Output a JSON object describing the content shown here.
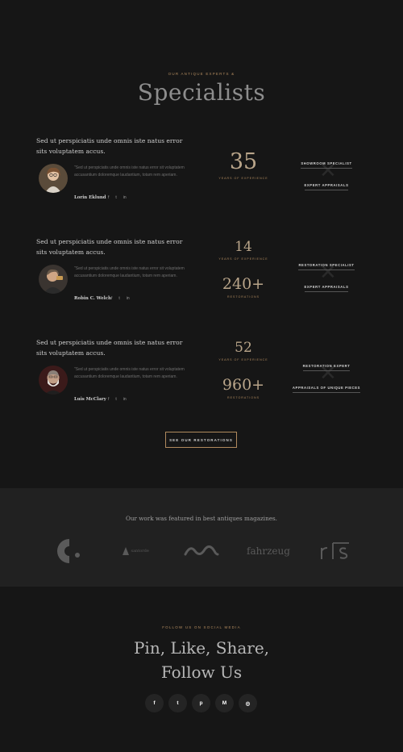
{
  "header": {
    "eyebrow": "OUR ANTIQUE EXPERTS &",
    "title": "Specialists"
  },
  "specialists": [
    {
      "lead": "Sed ut perspiciatis unde omnis iste natus error sits voluptatem accus.",
      "quote": "\"Sed ut perspiciatis unde omnis iste natus error sit voluptatem accusantium doloremque laudantium, totam rem aperiam.",
      "name": "Lorin Eklund",
      "stats": [
        {
          "num": "35",
          "label": "YEARS OF EXPERIENCE"
        }
      ],
      "roles": [
        "SHOWROOM SPECIALIST",
        "EXPERT APPRAISALS"
      ]
    },
    {
      "lead": "Sed ut perspiciatis unde omnis iste natus error sits voluptatem accus.",
      "quote": "\"Sed ut perspiciatis unde omnis iste natus error sit voluptatem accusantium doloremque laudantium, totam rem aperiam.",
      "name": "Robin C. Welch",
      "stats": [
        {
          "num": "14",
          "label": "YEARS OF EXPERIENCE"
        },
        {
          "num": "240+",
          "label": "RESTORATIONS"
        }
      ],
      "roles": [
        "RESTORATION SPECIALIST",
        "EXPERT APPRAISALS"
      ]
    },
    {
      "lead": "Sed ut perspiciatis unde omnis iste natus error sits voluptatem accus.",
      "quote": "\"Sed ut perspiciatis unde omnis iste natus error sit voluptatem accusantium doloremque laudantium, totam rem aperiam.",
      "name": "Luis McClary",
      "stats": [
        {
          "num": "52",
          "label": "YEARS OF EXPERIENCE"
        },
        {
          "num": "960+",
          "label": "RESTORATIONS"
        }
      ],
      "roles": [
        "RESTORATION EXPERT",
        "APPRAISALS OF UNIQUE PIECES"
      ]
    }
  ],
  "social_icons": [
    "f",
    "t",
    "in"
  ],
  "cta": {
    "label": "SEE OUR RESTORATIONS"
  },
  "featured": {
    "title": "Our work was featured in best antiques magazines.",
    "logos": [
      {
        "name": "c-logo",
        "text": ""
      },
      {
        "name": "santorde-logo",
        "text": "santorde"
      },
      {
        "name": "wave-logo",
        "text": ""
      },
      {
        "name": "fahrzeug-logo",
        "text": "fahrzeug"
      },
      {
        "name": "rs-logo",
        "text": "r|s"
      }
    ]
  },
  "footer": {
    "eyebrow": "FOLLOW US ON SOCIAL MEDIA",
    "title_line1": "Pin, Like, Share,",
    "title_line2": "Follow Us",
    "social_buttons": [
      {
        "name": "facebook",
        "glyph": "f"
      },
      {
        "name": "twitter",
        "glyph": "t"
      },
      {
        "name": "pinterest",
        "glyph": "p"
      },
      {
        "name": "medium",
        "glyph": "M"
      },
      {
        "name": "instagram",
        "glyph": "◎"
      }
    ]
  },
  "colors": {
    "background": "#161616",
    "band": "#212121",
    "accent": "#b08a5e",
    "number": "#b9a58a"
  }
}
